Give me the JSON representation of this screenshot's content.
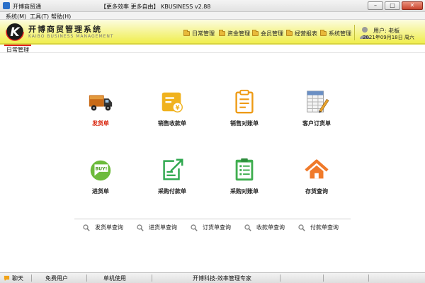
{
  "window": {
    "title": "开博商贸通",
    "slogan": "【更多效率 更多自由】  KBUSINESS v2.88",
    "buttons": {
      "minimize": "–",
      "maximize": "□",
      "close": "✕"
    }
  },
  "menubar": [
    "系统(M)",
    "工具(T)",
    "帮助(H)"
  ],
  "brand": {
    "title": "开博商贸管理系统",
    "subtitle": "KAIBO BUSINESS MANAGEMENT",
    "logo_letter": "K"
  },
  "nav": [
    "日常管理",
    "资金管理",
    "会员管理",
    "经营报表",
    "系统管理"
  ],
  "user": {
    "label": "用户: 老板",
    "date": "2021年09月18日 周六"
  },
  "tab": "日常管理",
  "tiles": [
    {
      "label": "发货单",
      "icon": "truck-icon"
    },
    {
      "label": "销售收款单",
      "icon": "yen-card-icon"
    },
    {
      "label": "销售对账单",
      "icon": "clipboard-icon"
    },
    {
      "label": "客户订货单",
      "icon": "spreadsheet-pen-icon"
    },
    {
      "label": "进货单",
      "icon": "buy-tag-icon"
    },
    {
      "label": "采购付款单",
      "icon": "export-doc-icon"
    },
    {
      "label": "采购对账单",
      "icon": "checklist-icon"
    },
    {
      "label": "存货查询",
      "icon": "house-icon"
    }
  ],
  "queries": [
    "发货单查询",
    "进货单查询",
    "订货单查询",
    "收款单查询",
    "付款单查询"
  ],
  "status": {
    "chat": "聊天",
    "user_type": "免费用户",
    "mode": "单机使用",
    "vendor": "开博科技-效率管理专家"
  },
  "colors": {
    "accent_red": "#d81e06",
    "header_yellow": "#efed45",
    "icon_orange": "#e8a81c",
    "icon_green": "#4caf50"
  }
}
